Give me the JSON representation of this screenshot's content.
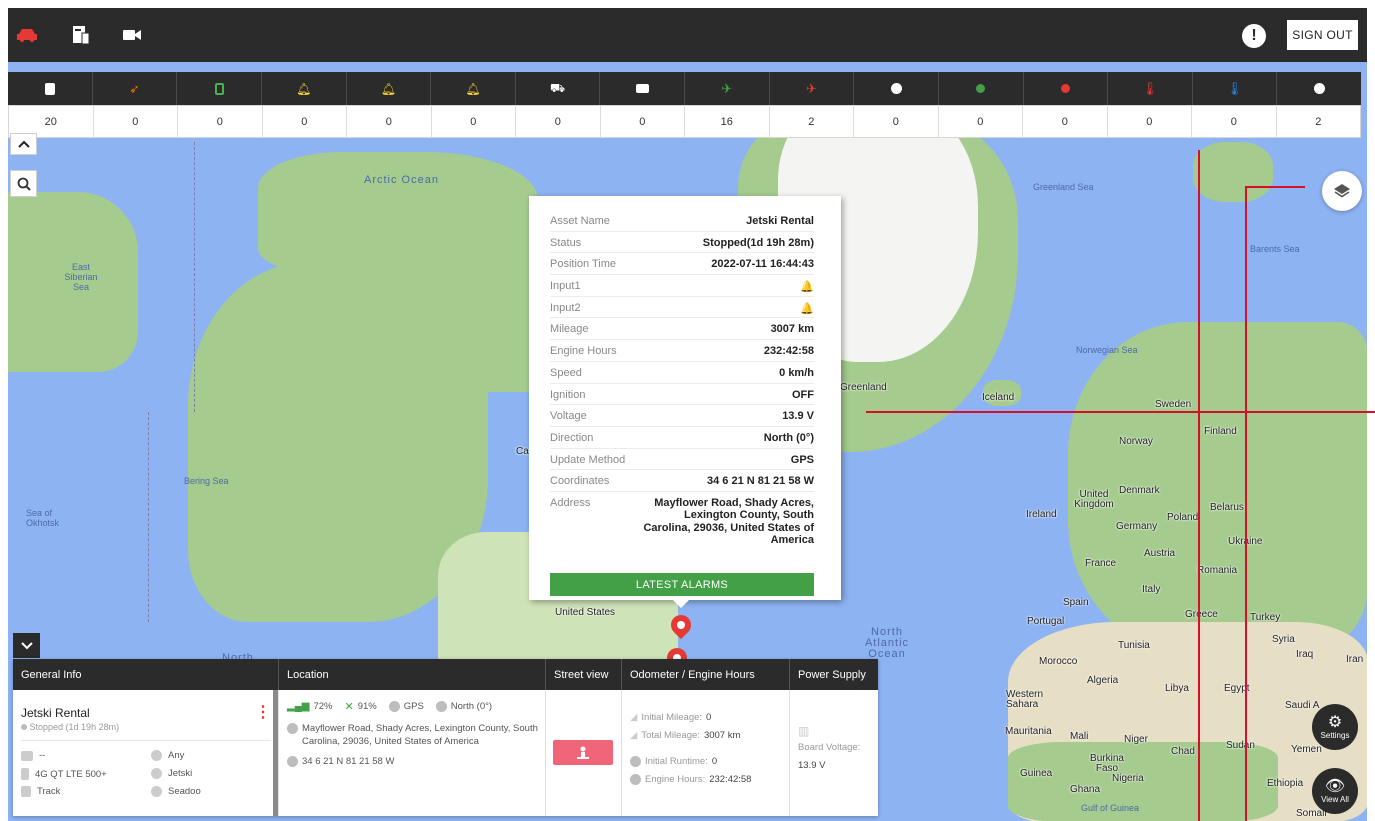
{
  "topbar": {
    "icons": [
      "car-icon",
      "report-icon",
      "video-camera-icon"
    ],
    "alert_icon": "!",
    "sign_out_label": "SIGN OUT"
  },
  "counters": [
    {
      "icon": "document-icon",
      "color": "#ffffff",
      "value": "20"
    },
    {
      "icon": "rocket-icon",
      "color": "#f57c00",
      "value": "0"
    },
    {
      "icon": "battery-icon",
      "color": "#4caf50",
      "value": "0"
    },
    {
      "icon": "bell-icon",
      "color": "#fdd835",
      "value": "0"
    },
    {
      "icon": "bell-icon",
      "color": "#fdd835",
      "value": "0"
    },
    {
      "icon": "bell-icon",
      "color": "#fdd835",
      "value": "0"
    },
    {
      "icon": "tow-icon",
      "color": "#ffffff",
      "value": "0"
    },
    {
      "icon": "card-icon",
      "color": "#ffffff",
      "value": "0"
    },
    {
      "icon": "satellite-icon",
      "color": "#43a047",
      "value": "16"
    },
    {
      "icon": "satellite-off-icon",
      "color": "#e53935",
      "value": "2"
    },
    {
      "icon": "clock-icon",
      "color": "#ffffff",
      "value": "0"
    },
    {
      "icon": "engine-on-icon",
      "color": "#43a047",
      "value": "0"
    },
    {
      "icon": "engine-off-icon",
      "color": "#e53935",
      "value": "0"
    },
    {
      "icon": "temperature-high-icon",
      "color": "#e53935",
      "value": "0"
    },
    {
      "icon": "temperature-low-icon",
      "color": "#1e88e5",
      "value": "0"
    },
    {
      "icon": "speed-icon",
      "color": "#ffffff",
      "value": "2"
    }
  ],
  "map": {
    "labels": {
      "arctic_ocean": "Arctic Ocean",
      "east_siberian_sea": "East Siberian Sea",
      "bering_sea": "Bering Sea",
      "sea_of_okhotsk": "Sea of Okhotsk",
      "greenland_sea": "Greenland Sea",
      "barents_sea": "Barents Sea",
      "norwegian_sea": "Norwegian Sea",
      "greenland": "Greenland",
      "iceland": "Iceland",
      "sweden": "Sweden",
      "finland": "Finland",
      "norway": "Norway",
      "united_kingdom": "United Kingdom",
      "denmark": "Denmark",
      "ireland": "Ireland",
      "poland": "Poland",
      "belarus": "Belarus",
      "germany": "Germany",
      "ukraine": "Ukraine",
      "france": "France",
      "austria": "Austria",
      "romania": "Romania",
      "italy": "Italy",
      "spain": "Spain",
      "portugal": "Portugal",
      "greece": "Greece",
      "turkey": "Turkey",
      "syria": "Syria",
      "iraq": "Iraq",
      "iran": "Iran",
      "tunisia": "Tunisia",
      "morocco": "Morocco",
      "algeria": "Algeria",
      "libya": "Libya",
      "egypt": "Egypt",
      "western_sahara": "Western Sahara",
      "mauritania": "Mauritania",
      "mali": "Mali",
      "niger": "Niger",
      "chad": "Chad",
      "sudan": "Sudan",
      "burkina_faso": "Burkina Faso",
      "guinea": "Guinea",
      "nigeria": "Nigeria",
      "ghana": "Ghana",
      "ethiopia": "Ethiopia",
      "gulf_of_guinea": "Gulf of Guinea",
      "north_atlantic_ocean": "North Atlantic Ocean",
      "united_states": "United States",
      "north": "North",
      "saudi": "Saudi A",
      "yemen": "Yemen",
      "somalia": "Somali",
      "cut_ca": "Ca"
    }
  },
  "popup": {
    "rows": [
      {
        "key": "Asset Name",
        "value": "Jetski Rental"
      },
      {
        "key": "Status",
        "value": "Stopped(1d 19h 28m)"
      },
      {
        "key": "Position Time",
        "value": "2022-07-11 16:44:43"
      },
      {
        "key": "Input1",
        "value": "🔔"
      },
      {
        "key": "Input2",
        "value": "🔔"
      },
      {
        "key": "Mileage",
        "value": "3007 km"
      },
      {
        "key": "Engine Hours",
        "value": "232:42:58"
      },
      {
        "key": "Speed",
        "value": "0 km/h"
      },
      {
        "key": "Ignition",
        "value": "OFF"
      },
      {
        "key": "Voltage",
        "value": "13.9 V"
      },
      {
        "key": "Direction",
        "value": "North (0°)"
      },
      {
        "key": "Update Method",
        "value": "GPS"
      },
      {
        "key": "Coordinates",
        "value": "34 6 21 N 81 21 58 W"
      },
      {
        "key": "Address",
        "value": "Mayflower Road, Shady Acres, Lexington County, South Carolina, 29036, United States of America"
      }
    ],
    "alarm_button": "LATEST ALARMS"
  },
  "info_panel": {
    "headers": {
      "general": "General Info",
      "location": "Location",
      "street": "Street view",
      "odometer": "Odometer / Engine Hours",
      "power": "Power Supply"
    },
    "general": {
      "name": "Jetski Rental",
      "status": "Stopped (1d 19h 28m)",
      "device_top": "--",
      "device": "4G QT LTE 500+",
      "mode": "Track",
      "driver": "Any",
      "type": "Jetski",
      "model": "Seadoo"
    },
    "location": {
      "signal": "72%",
      "satellites": "91%",
      "method": "GPS",
      "direction": "North (0°)",
      "address": "Mayflower Road, Shady Acres, Lexington County, South Carolina, 29036, United States of America",
      "coords": "34 6 21 N 81 21 58 W"
    },
    "odometer": {
      "initial_mileage_label": "Initial Mileage:",
      "initial_mileage": "0",
      "total_mileage_label": "Total Mileage:",
      "total_mileage": "3007 km",
      "initial_runtime_label": "Initial Runtime:",
      "initial_runtime": "0",
      "engine_hours_label": "Engine Hours:",
      "engine_hours": "232:42:58"
    },
    "power": {
      "label": "Board Voltage:",
      "value": "13.9 V"
    }
  },
  "fabs": {
    "settings": "Settings",
    "view_all": "View All"
  },
  "colors": {
    "dark": "#2b2b2b",
    "accent_green": "#43a047",
    "accent_red": "#e53935",
    "street_view": "#f06577",
    "water": "#8db3f2",
    "land": "#a5cc8e"
  }
}
